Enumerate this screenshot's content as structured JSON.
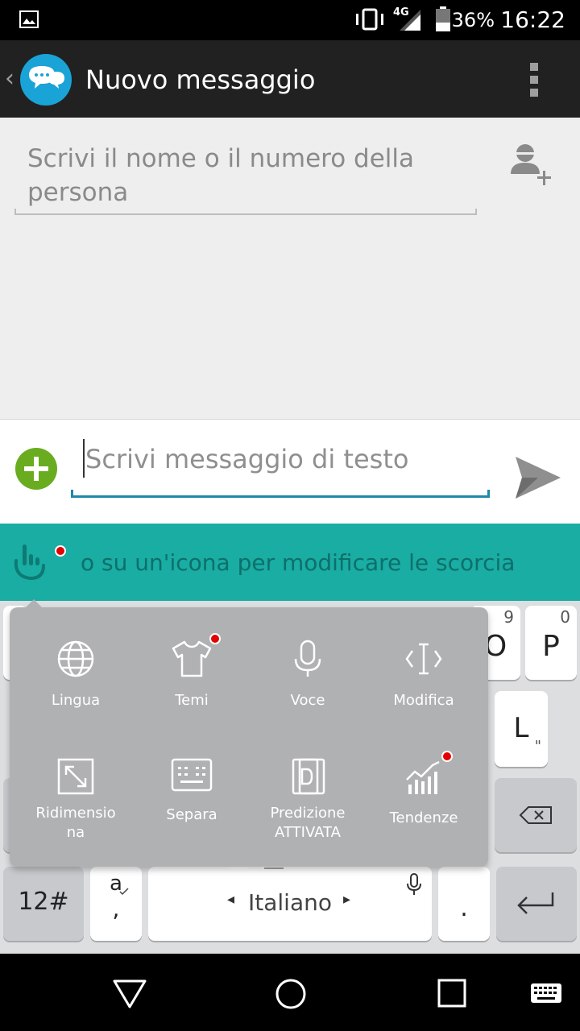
{
  "status_bar": {
    "network": "4G",
    "battery_percent": "36%",
    "time": "16:22"
  },
  "app_bar": {
    "back_glyph": "‹",
    "title": "Nuovo messaggio"
  },
  "recipient": {
    "placeholder": "Scrivi il nome o il numero della persona"
  },
  "compose": {
    "placeholder": "Scrivi messaggio di testo"
  },
  "keyboard_tip": {
    "text": "o su un'icona per modificare le scorcia"
  },
  "keyboard_popup": {
    "items": [
      {
        "label": "Lingua"
      },
      {
        "label": "Temi"
      },
      {
        "label": "Voce"
      },
      {
        "label": "Modifica"
      },
      {
        "label": "Ridimensio\nna"
      },
      {
        "label": "Separa"
      },
      {
        "label": "Predizione\nATTIVATA"
      },
      {
        "label": "Tendenze"
      }
    ]
  },
  "keyboard": {
    "key_o": "O",
    "key_o_sub": "9",
    "key_p": "P",
    "key_p_sub": "0",
    "key_l": "L",
    "key_l_sub": "\"",
    "key_numbers": "12#",
    "key_punct_top": "a",
    "key_punct_bottom": ",",
    "space_label": "Italiano",
    "space_left_arrow": "◂",
    "space_right_arrow": "▸",
    "key_period": "."
  },
  "colors": {
    "app_bar": "#212121",
    "teal_bar": "#19ada4",
    "accent_blue": "#1e88a8",
    "add_green": "#6aac1f",
    "notification_red": "#e30000"
  }
}
